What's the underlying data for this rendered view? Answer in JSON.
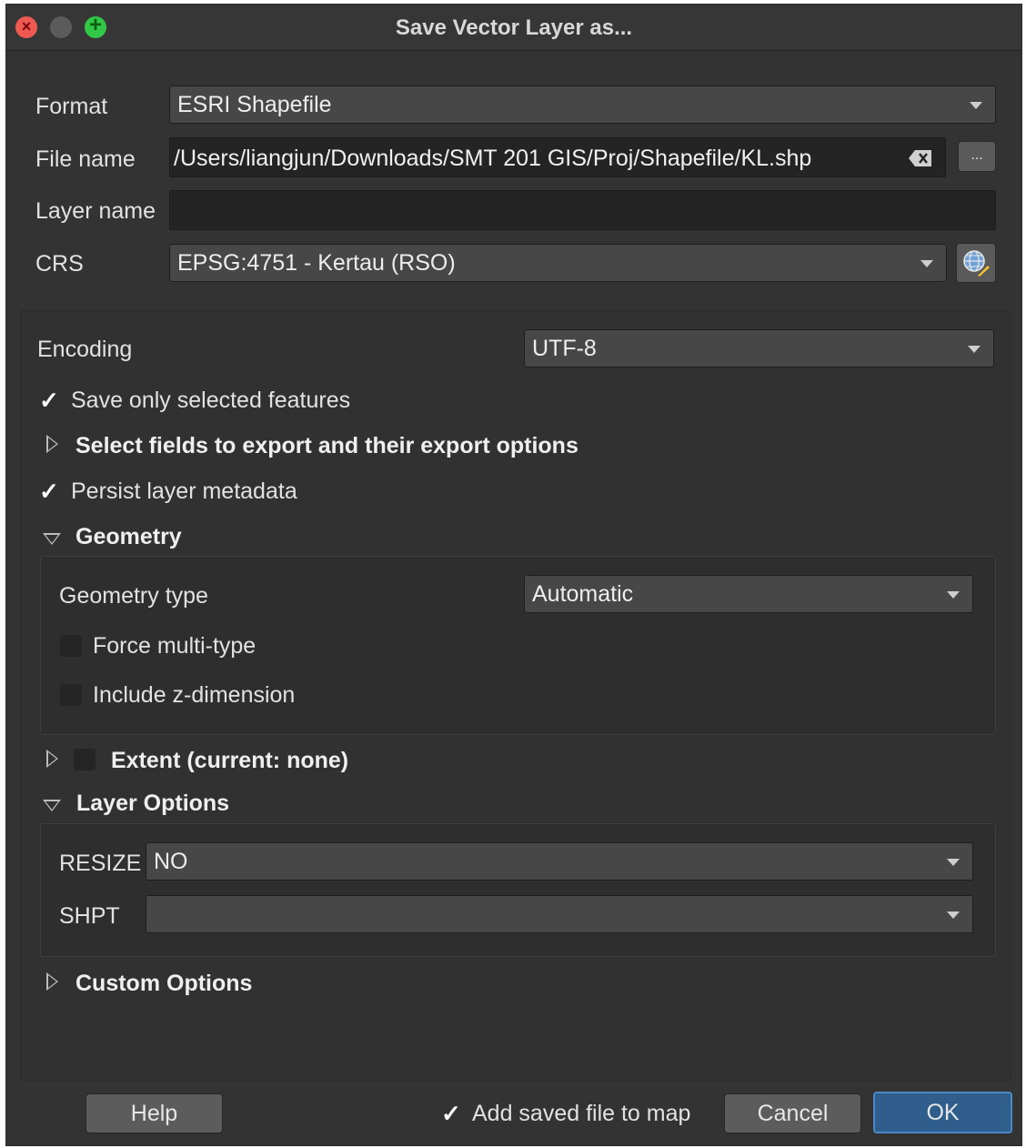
{
  "window": {
    "title": "Save Vector Layer as..."
  },
  "form": {
    "format_label": "Format",
    "format_value": "ESRI Shapefile",
    "filename_label": "File name",
    "filename_value": "/Users/liangjun/Downloads/SMT 201 GIS/Proj/Shapefile/KL.shp",
    "browse_label": "...",
    "layername_label": "Layer name",
    "layername_value": "",
    "crs_label": "CRS",
    "crs_value": "EPSG:4751 - Kertau (RSO)"
  },
  "options": {
    "encoding_label": "Encoding",
    "encoding_value": "UTF-8",
    "save_selected_label": "Save only selected features",
    "save_selected_checked": true,
    "select_fields_label": "Select fields to export and their export options",
    "persist_metadata_label": "Persist layer metadata",
    "persist_metadata_checked": true,
    "geometry_section": "Geometry",
    "geometry_type_label": "Geometry type",
    "geometry_type_value": "Automatic",
    "force_multi_label": "Force multi-type",
    "force_multi_checked": false,
    "include_z_label": "Include z-dimension",
    "include_z_checked": false,
    "extent_label": "Extent (current: none)",
    "extent_checked": false,
    "layer_options_section": "Layer Options",
    "resize_label": "RESIZE",
    "resize_value": "NO",
    "shpt_label": "SHPT",
    "shpt_value": "",
    "custom_options_section": "Custom Options"
  },
  "footer": {
    "help_label": "Help",
    "add_to_map_label": "Add saved file to map",
    "add_to_map_checked": true,
    "cancel_label": "Cancel",
    "ok_label": "OK"
  },
  "colors": {
    "background": "#333333",
    "accent": "#2f5d8c"
  }
}
